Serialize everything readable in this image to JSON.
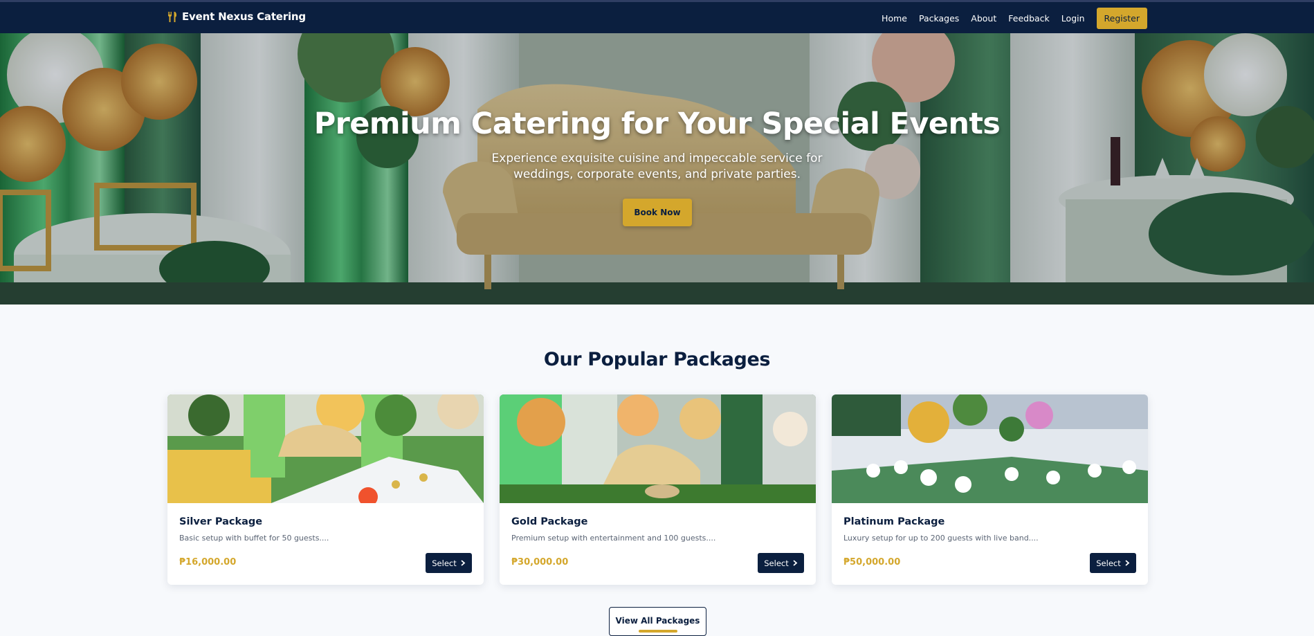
{
  "nav": {
    "brand": "Event Nexus Catering",
    "brand_icon": "utensils-icon",
    "links": [
      "Home",
      "Packages",
      "About",
      "Feedback",
      "Login"
    ],
    "register": "Register"
  },
  "hero": {
    "title": "Premium Catering for Your Special Events",
    "subtitle": "Experience exquisite cuisine and impeccable service for weddings, corporate events, and private parties.",
    "cta": "Book Now"
  },
  "packages": {
    "section_title": "Our Popular Packages",
    "items": [
      {
        "name": "Silver Package",
        "description": "Basic setup with buffet for 50 guests....",
        "price": "₱16,000.00",
        "button": "Select"
      },
      {
        "name": "Gold Package",
        "description": "Premium setup with entertainment and 100 guests....",
        "price": "₱30,000.00",
        "button": "Select"
      },
      {
        "name": "Platinum Package",
        "description": "Luxury setup for up to 200 guests with live band....",
        "price": "₱50,000.00",
        "button": "Select"
      }
    ],
    "view_all": "View All Packages"
  },
  "colors": {
    "navy": "#0b1f3f",
    "gold": "#d4a72c",
    "background": "#f7f9fc"
  }
}
